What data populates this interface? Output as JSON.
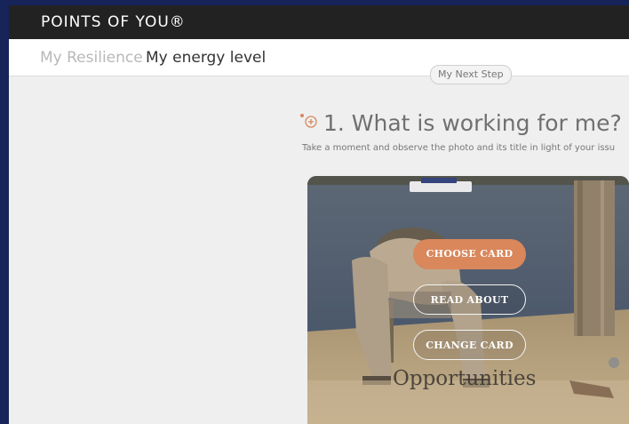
{
  "header": {
    "brand": "POINTS OF YOU®"
  },
  "breadcrumb": {
    "parent": "My Resilience",
    "current": "My energy level"
  },
  "next_step_label": "My Next Step",
  "step": {
    "title": "1. What is working for me?",
    "description": "Take a moment and observe the photo and its title in light of your issu"
  },
  "card": {
    "title": "Opportunities",
    "buttons": {
      "choose": "CHOOSE CARD",
      "read": "READ ABOUT",
      "change": "CHANGE CARD"
    }
  },
  "colors": {
    "accent": "#d9875b",
    "topbar": "#222222",
    "background": "#17245a"
  }
}
